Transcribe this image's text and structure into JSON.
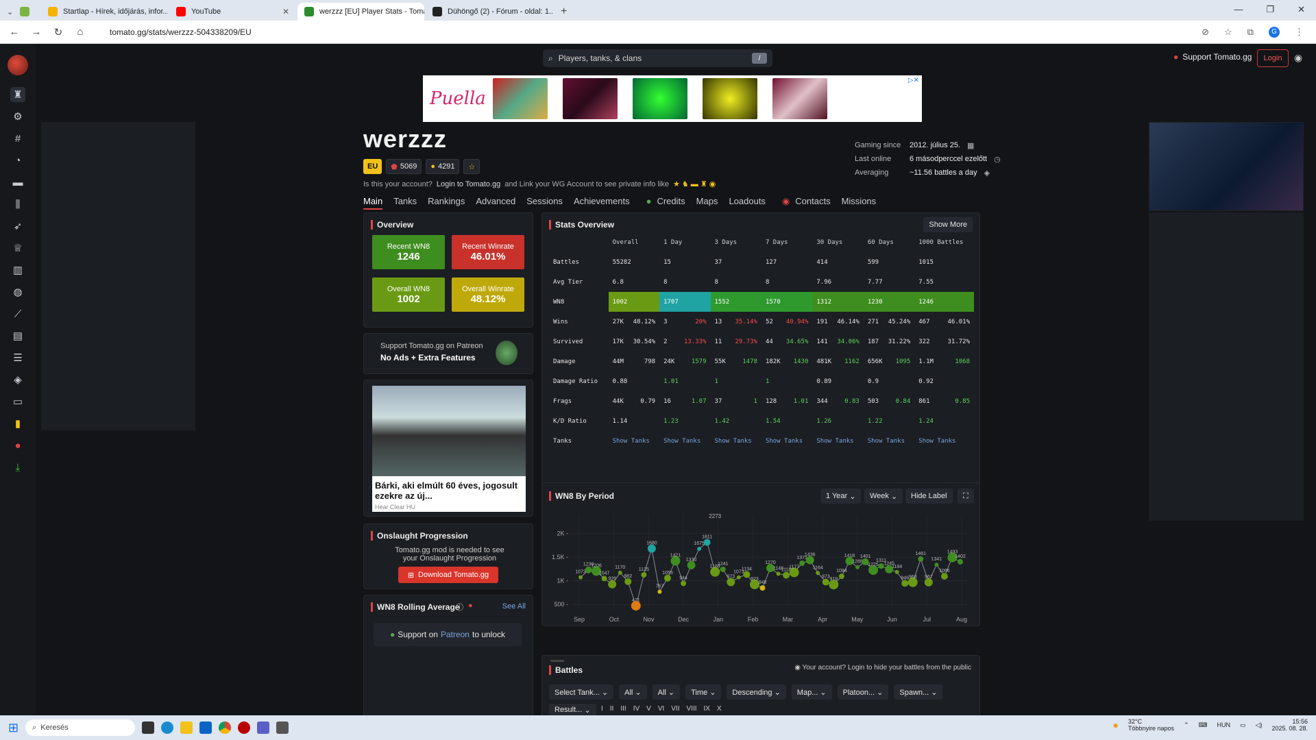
{
  "browser": {
    "tabs": [
      {
        "label": "Startlap - Hírek, időjárás, infor...",
        "color": "#f4b400"
      },
      {
        "label": "YouTube",
        "color": "#ff0000"
      },
      {
        "label": "werzzz [EU] Player Stats - Toma...",
        "color": "#2d8a2d"
      },
      {
        "label": "Dühöngő (2) - Fórum - oldal: 1...",
        "color": "#222"
      }
    ],
    "url": "tomato.gg/stats/werzzz-504338209/EU"
  },
  "header": {
    "search_placeholder": "Players, tanks, & clans",
    "search_key": "/",
    "support": "Support Tomato.gg",
    "login": "Login"
  },
  "player": {
    "name": "werzzz",
    "region": "EU",
    "stat1": "5069",
    "stat2": "4291",
    "claim_a": "Is this your account?",
    "claim_b": "Login to Tomato.gg",
    "claim_c": "and Link your WG Account to see private info like",
    "gaming_since_label": "Gaming since",
    "gaming_since": "2012. július 25.",
    "last_online_label": "Last online",
    "last_online": "6 másodperccel ezelőtt",
    "averaging_label": "Averaging",
    "averaging": "~11.56 battles a day"
  },
  "nav": {
    "tabs": [
      "Main",
      "Tanks",
      "Rankings",
      "Advanced",
      "Sessions",
      "Achievements",
      "Credits",
      "Maps",
      "Loadouts",
      "Contacts",
      "Missions"
    ]
  },
  "overview": {
    "title": "Overview",
    "boxes": [
      {
        "label": "Recent WN8",
        "value": "1246",
        "color": "#3e8e1f"
      },
      {
        "label": "Recent Winrate",
        "value": "46.01%",
        "color": "#c9322b"
      },
      {
        "label": "Overall WN8",
        "value": "1002",
        "color": "#6a9a14"
      },
      {
        "label": "Overall Winrate",
        "value": "48.12%",
        "color": "#bfa90a"
      }
    ]
  },
  "patreon": {
    "line1": "Support Tomato.gg on Patreon",
    "line2": "No Ads + Extra Features"
  },
  "ad": {
    "headline": "Bárki, aki elmúlt 60 éves, jogosult ezekre az új...",
    "source": "Hear Clear HU"
  },
  "onslaught": {
    "title": "Onslaught Progression",
    "text": "Tomato.gg mod is needed to see your Onslaught Progression",
    "button": "Download Tomato.gg"
  },
  "rolling": {
    "title": "WN8 Rolling Average",
    "see_all": "See All",
    "unlock_a": "Support on",
    "unlock_b": "Patreon",
    "unlock_c": "to unlock"
  },
  "stats_overview": {
    "title": "Stats Overview",
    "show_more": "Show More",
    "columns": [
      "",
      "Overall",
      "1 Day",
      "3 Days",
      "7 Days",
      "30 Days",
      "60 Days",
      "1000 Battles"
    ],
    "rows": [
      {
        "label": "Battles",
        "cells": [
          "55282",
          "15",
          "37",
          "127",
          "414",
          "599",
          "1015"
        ]
      },
      {
        "label": "Avg Tier",
        "cells": [
          "6.8",
          "8",
          "8",
          "8",
          "7.96",
          "7.77",
          "7.55"
        ]
      },
      {
        "label": "WN8",
        "cells": [
          "1002",
          "1707",
          "1552",
          "1570",
          "1312",
          "1230",
          "1246"
        ]
      },
      {
        "label": "Wins",
        "cells": [
          "27K|48.12%",
          "3|20%",
          "13|35.14%",
          "52|40.94%",
          "191|46.14%",
          "271|45.24%",
          "467|46.01%"
        ]
      },
      {
        "label": "Survived",
        "cells": [
          "17K|30.54%",
          "2|13.33%",
          "11|29.73%",
          "44|34.65%",
          "141|34.06%",
          "187|31.22%",
          "322|31.72%"
        ]
      },
      {
        "label": "Damage",
        "cells": [
          "44M|798",
          "24K|1579",
          "55K|1478",
          "182K|1430",
          "481K|1162",
          "656K|1095",
          "1.1M|1068"
        ]
      },
      {
        "label": "Damage Ratio",
        "cells": [
          "0.88",
          "1.01",
          "1",
          "1",
          "0.89",
          "0.9",
          "0.92"
        ]
      },
      {
        "label": "Frags",
        "cells": [
          "44K|0.79",
          "16|1.07",
          "37|1",
          "128|1.01",
          "344|0.83",
          "503|0.84",
          "861|0.85"
        ]
      },
      {
        "label": "K/D Ratio",
        "cells": [
          "1.14",
          "1.23",
          "1.42",
          "1.54",
          "1.26",
          "1.22",
          "1.24"
        ]
      },
      {
        "label": "Tanks",
        "cells": [
          "Show Tanks",
          "Show Tanks",
          "Show Tanks",
          "Show Tanks",
          "Show Tanks",
          "Show Tanks",
          "Show Tanks"
        ]
      }
    ],
    "wn8_colors": [
      "#6a9a14",
      "#1fa3a3",
      "#2e9a2e",
      "#2e9a2e",
      "#3e8e1f",
      "#3e8e1f",
      "#3e8e1f"
    ]
  },
  "wn8_period": {
    "title": "WN8 By Period",
    "range": "1 Year",
    "period": "Week",
    "hide_label": "Hide Label"
  },
  "chart_data": {
    "type": "line",
    "title": "WN8 By Period",
    "x_ticks": [
      "Sep",
      "Oct",
      "Nov",
      "Dec",
      "Jan",
      "Feb",
      "Mar",
      "Apr",
      "May",
      "Jun",
      "Jul",
      "Aug"
    ],
    "y_ticks": [
      "500",
      "1K",
      "1.5K",
      "2K"
    ],
    "ylim": [
      400,
      2400
    ],
    "values": [
      1073,
      1230,
      1206,
      1047,
      926,
      1170,
      982,
      471,
      1125,
      1680,
      767,
      1055,
      1421,
      944,
      1330,
      1675,
      1811,
      1188,
      1241,
      973,
      1073,
      1134,
      923,
      848,
      1270,
      1148,
      1118,
      1177,
      1371,
      1436,
      1164,
      973,
      919,
      1094,
      1418,
      1288,
      1401,
      1225,
      1311,
      1245,
      1184,
      946,
      968,
      1461,
      967,
      1341,
      1096,
      1493,
      1402
    ]
  },
  "battles": {
    "title": "Battles",
    "privacy": "Your account? Login to hide your battles from the public",
    "filters": [
      "Select Tank...",
      "All",
      "All",
      "Time",
      "Descending",
      "Map...",
      "Platoon...",
      "Spawn..."
    ],
    "result": "Result...",
    "tiers": [
      "I",
      "II",
      "III",
      "IV",
      "V",
      "VI",
      "VII",
      "VIII",
      "IX",
      "X"
    ]
  },
  "taskbar": {
    "search": "Keresés",
    "weather": "32°C",
    "weather_sub": "Többnyire napos",
    "lang": "HUN",
    "time": "15:56",
    "date": "2025. 08. 28."
  }
}
